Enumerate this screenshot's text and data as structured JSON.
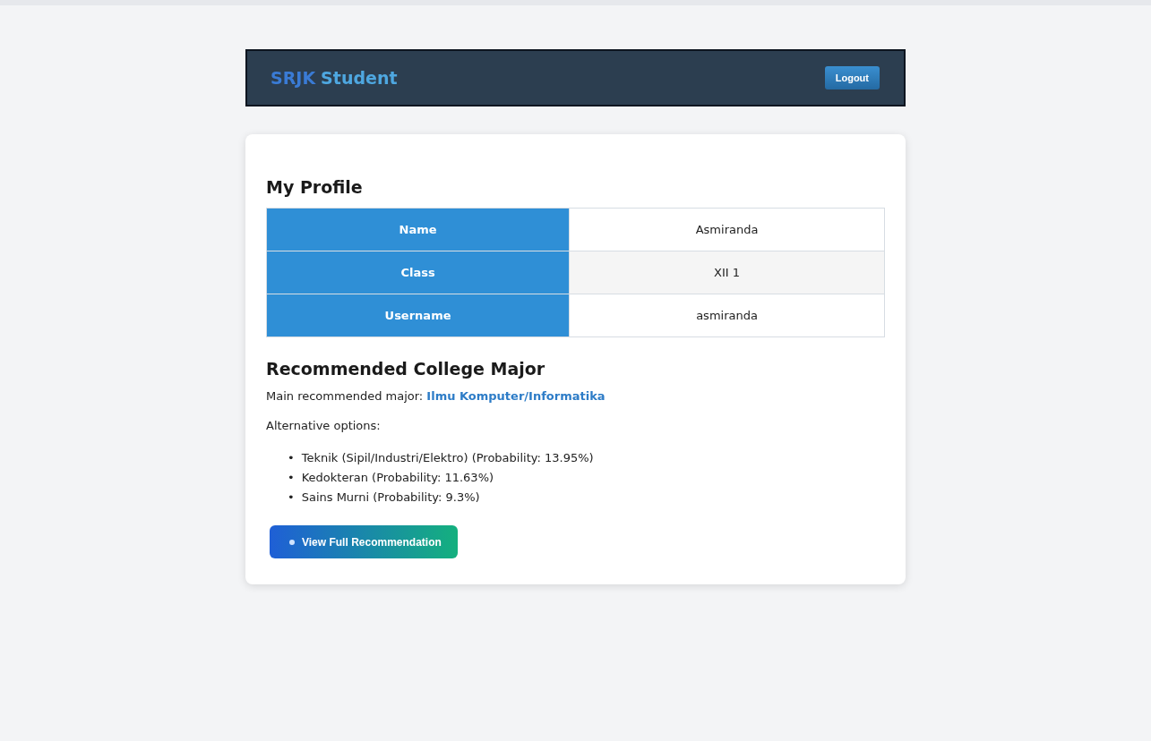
{
  "navbar": {
    "brand_prefix": "SRJK",
    "brand_suffix": "Student",
    "logout_button": "Logout"
  },
  "profile": {
    "title": "My Profile",
    "rows": [
      {
        "label": "Name",
        "value": "Asmiranda"
      },
      {
        "label": "Class",
        "value": "XII 1"
      },
      {
        "label": "Username",
        "value": "asmiranda"
      }
    ]
  },
  "recommendation": {
    "title": "Recommended College Major",
    "main_label": "Main recommended major:",
    "main_major": "Ilmu Komputer/Informatika",
    "alternatives_label": "Alternative options:",
    "bullet": "•",
    "alternatives": [
      "Teknik (Sipil/Industri/Elektro) (Probability: 13.95%)",
      "Kedokteran (Probability: 11.63%)",
      "Sains Murni (Probability: 9.3%)"
    ],
    "button": "View Full Recommendation"
  }
}
